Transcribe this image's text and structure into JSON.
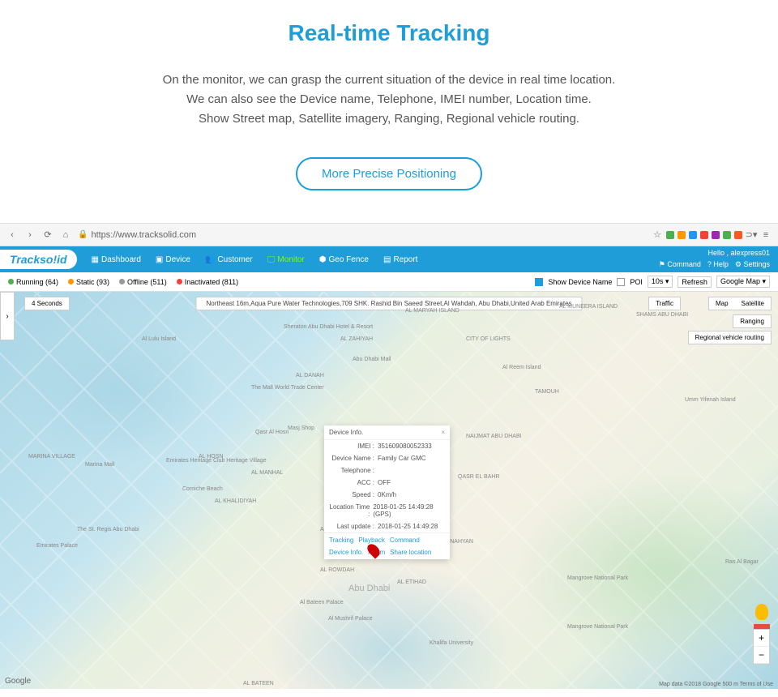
{
  "hero": {
    "title": "Real-time Tracking",
    "desc_line1": "On the monitor, we can grasp the current situation of the device in real time location.",
    "desc_line2": "We can also see the Device name, Telephone, IMEI number, Location time.",
    "desc_line3": "Show Street map, Satellite imagery, Ranging, Regional vehicle routing.",
    "button": "More Precise Positioning"
  },
  "browser": {
    "url": "https://www.tracksolid.com"
  },
  "app": {
    "logo": "Trackso!id",
    "nav": {
      "dashboard": "Dashboard",
      "device": "Device",
      "customer": "Customer",
      "monitor": "Monitor",
      "geofence": "Geo Fence",
      "report": "Report"
    },
    "user": {
      "hello": "Hello , alexpress01",
      "command": "Command",
      "help": "Help",
      "settings": "Settings"
    }
  },
  "status": {
    "running": "Running (64)",
    "static": "Static (93)",
    "offline": "Offline (511)",
    "inactivated": "Inactivated (811)",
    "show_device": "Show Device Name",
    "poi": "POI",
    "interval": "10s ▾",
    "refresh": "Refresh",
    "map_provider": "Google Map ▾"
  },
  "map": {
    "address": "Northeast 16m,Aqua Pure Water Technologies,709 SHK. Rashid Bin Saeed Street,Al Wahdah, Abu Dhabi,United Arab Emirates",
    "seconds": "4 Seconds",
    "traffic": "Traffic",
    "type_map": "Map",
    "type_sat": "Satellite",
    "ranging": "Ranging",
    "routing": "Regional vehicle routing",
    "attribution": "Map data ©2018 Google   500 m   Terms of Use",
    "google": "Google"
  },
  "popup": {
    "title": "Device Info.",
    "imei_l": "IMEI :",
    "imei_v": "351609080052333",
    "name_l": "Device Name :",
    "name_v": "Family Car GMC",
    "tel_l": "Telephone :",
    "tel_v": "",
    "acc_l": "ACC :",
    "acc_v": "OFF",
    "speed_l": "Speed :",
    "speed_v": "0Km/h",
    "loc_l": "Location Time :",
    "loc_v": "2018-01-25 14:49:28 (GPS)",
    "upd_l": "Last update :",
    "upd_v": "2018-01-25 14:49:28",
    "links": {
      "tracking": "Tracking",
      "playback": "Playback",
      "command": "Command",
      "device_info": "Device Info.",
      "alarm": "Alarm",
      "share": "Share location"
    }
  },
  "places": {
    "abudhabi": "Abu Dhabi",
    "mangrove": "Mangrove National Park",
    "corniche": "Corniche Beach",
    "emirates": "Emirates Palace",
    "marina": "MARINA VILLAGE",
    "alreem": "Al Reem Island",
    "almaryah": "AL MARYAH ISLAND",
    "lulu": "Al Lulu Island",
    "almuneera": "AL MUNEERA ISLAND",
    "shams": "SHAMS ABU DHABI",
    "umm": "Umm Yifenah Island",
    "khalifa": "Khalifa University",
    "tamouh": "TAMOUH",
    "naijmat": "NAIJMAT ABU DHABI",
    "cityoflights": "CITY OF LIGHTS",
    "sheraton": "Sheraton Abu Dhabi Hotel & Resort",
    "abudhabi_mall": "Abu Dhabi Mall",
    "marina_mall": "Marina Mall",
    "qasr": "Qasr Al Hosn",
    "heritage": "Emirates Heritage Club Heritage Village",
    "stregis": "The St. Regis Abu Dhabi",
    "wtc": "The Mall World Trade Center",
    "bateen": "Al Bateen Palace",
    "mushrif": "Al Mushrif Palace",
    "masjid": "Masj Shop",
    "al_bagar": "Ras Al Bagar",
    "al_bateen": "AL BATEEN",
    "al_danah": "AL DANAH",
    "al_zahiyah": "AL ZAHIYAH",
    "al_manhal": "AL MANHAL",
    "al_hosn": "AL HOSN",
    "al_khalidiyah": "AL KHALIDIYAH",
    "al_zaab": "AL ZAAB",
    "al_rowdah": "AL ROWDAH",
    "al_etihad": "AL ETIHAD",
    "al_nahyan": "AL NAHYAN",
    "qasr_el_bahr": "QASR EL BAHR"
  }
}
